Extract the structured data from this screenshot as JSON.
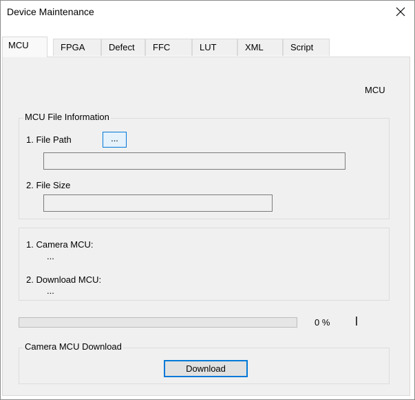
{
  "window": {
    "title": "Device Maintenance"
  },
  "tabs": [
    {
      "label": "MCU",
      "active": true
    },
    {
      "label": "FPGA",
      "active": false
    },
    {
      "label": "Defect",
      "active": false
    },
    {
      "label": "FFC",
      "active": false
    },
    {
      "label": "LUT",
      "active": false
    },
    {
      "label": "XML",
      "active": false
    },
    {
      "label": "Script",
      "active": false
    }
  ],
  "mcu_panel": {
    "header_label": "MCU",
    "file_info": {
      "group_label": "MCU File Information",
      "file_path_label": "1. File Path",
      "browse_button": "...",
      "file_path_value": "",
      "file_size_label": "2. File Size",
      "file_size_value": ""
    },
    "versions": {
      "camera_mcu_label": "1. Camera MCU:",
      "camera_mcu_value": "...",
      "download_mcu_label": "2. Download MCU:",
      "download_mcu_value": "..."
    },
    "progress": {
      "value_percent": 0,
      "text": "0 %"
    },
    "download": {
      "group_label": "Camera MCU Download",
      "button_label": "Download"
    }
  },
  "icons": {
    "close": "close-icon"
  }
}
